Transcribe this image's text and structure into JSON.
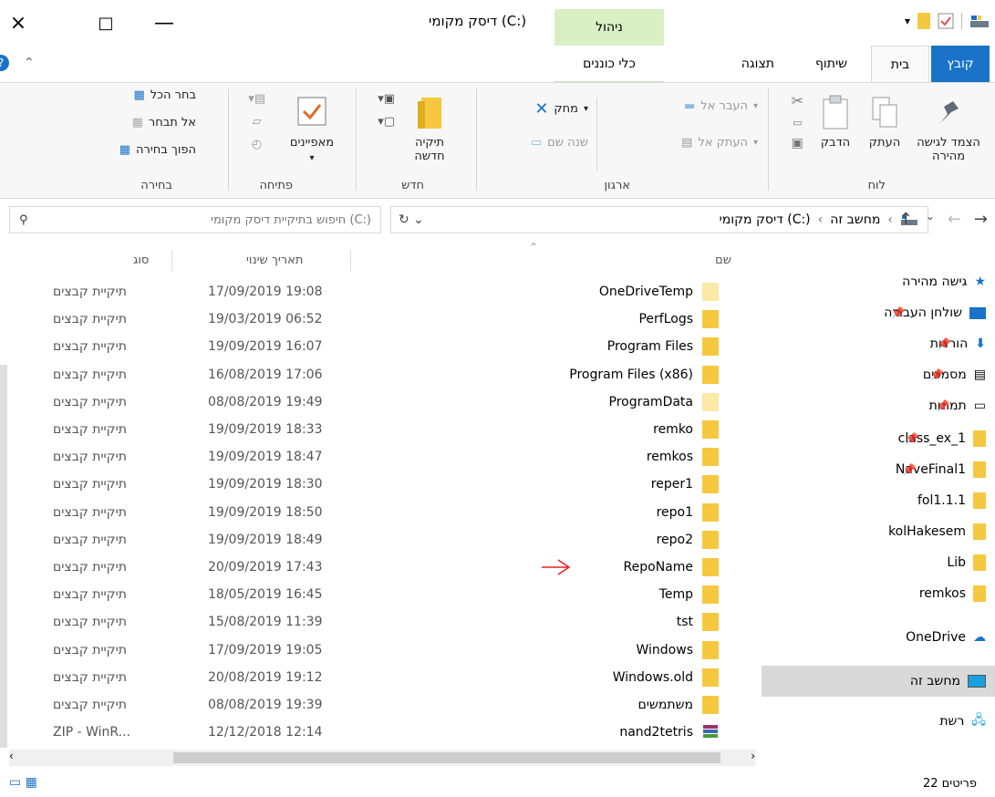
{
  "window": {
    "title": "דיסק מקומי (C:)",
    "manage_label": "ניהול",
    "close": "×",
    "maximize": "□",
    "minimize": "—"
  },
  "tabs": {
    "file": "קובץ",
    "home": "בית",
    "share": "שיתוף",
    "view": "תצוגה",
    "drive_tools": "כלי כוננים"
  },
  "ribbon": {
    "clipboard": {
      "label": "לוח",
      "pin": "הצמד לגישה מהירה",
      "copy": "העתק",
      "paste": "הדבק"
    },
    "organize": {
      "label": "ארגון",
      "move_to": "העבר אל",
      "copy_to": "העתק אל",
      "delete": "מחק",
      "rename": "שנה שם"
    },
    "new": {
      "label": "חדש",
      "new_folder": "תיקיה חדשה"
    },
    "open": {
      "label": "פתיחה",
      "properties": "מאפיינים"
    },
    "select": {
      "label": "בחירה",
      "select_all": "בחר הכל",
      "select_none": "אל תבחר",
      "invert": "הפוך בחירה"
    }
  },
  "address": {
    "this_pc": "מחשב זה",
    "drive": "דיסק מקומי (C:)",
    "search_placeholder": "חיפוש בתיקיית דיסק מקומי (C:)"
  },
  "columns": {
    "name": "שם",
    "date": "תאריך שינוי",
    "type": "סוג"
  },
  "files": [
    {
      "name": "OneDriveTemp",
      "date": "17/09/2019 19:08",
      "type": "תיקיית קבצים",
      "icon": "folder-light"
    },
    {
      "name": "PerfLogs",
      "date": "19/03/2019 06:52",
      "type": "תיקיית קבצים",
      "icon": "folder"
    },
    {
      "name": "Program Files",
      "date": "19/09/2019 16:07",
      "type": "תיקיית קבצים",
      "icon": "folder"
    },
    {
      "name": "Program Files (x86)",
      "date": "16/08/2019 17:06",
      "type": "תיקיית קבצים",
      "icon": "folder"
    },
    {
      "name": "ProgramData",
      "date": "08/08/2019 19:49",
      "type": "תיקיית קבצים",
      "icon": "folder-light"
    },
    {
      "name": "remko",
      "date": "19/09/2019 18:33",
      "type": "תיקיית קבצים",
      "icon": "folder"
    },
    {
      "name": "remkos",
      "date": "19/09/2019 18:47",
      "type": "תיקיית קבצים",
      "icon": "folder"
    },
    {
      "name": "reper1",
      "date": "19/09/2019 18:30",
      "type": "תיקיית קבצים",
      "icon": "folder"
    },
    {
      "name": "repo1",
      "date": "19/09/2019 18:50",
      "type": "תיקיית קבצים",
      "icon": "folder"
    },
    {
      "name": "repo2",
      "date": "19/09/2019 18:49",
      "type": "תיקיית קבצים",
      "icon": "folder"
    },
    {
      "name": "RepoName",
      "date": "20/09/2019 17:43",
      "type": "תיקיית קבצים",
      "icon": "folder"
    },
    {
      "name": "Temp",
      "date": "18/05/2019 16:45",
      "type": "תיקיית קבצים",
      "icon": "folder"
    },
    {
      "name": "tst",
      "date": "15/08/2019 11:39",
      "type": "תיקיית קבצים",
      "icon": "folder"
    },
    {
      "name": "Windows",
      "date": "17/09/2019 19:05",
      "type": "תיקיית קבצים",
      "icon": "folder"
    },
    {
      "name": "Windows.old",
      "date": "20/08/2019 19:12",
      "type": "תיקיית קבצים",
      "icon": "folder"
    },
    {
      "name": "משתמשים",
      "date": "08/08/2019 19:39",
      "type": "תיקיית קבצים",
      "icon": "folder"
    },
    {
      "name": "nand2tetris",
      "date": "12/12/2018 12:14",
      "type": "ZIP - WinR...",
      "icon": "winrar"
    }
  ],
  "nav": {
    "quick_access": "גישה מהירה",
    "desktop": "שולחן העבודה",
    "downloads": "הורדות",
    "documents": "מסמכים",
    "pictures": "תמונות",
    "class_ex_1": "class_ex_1",
    "navefinal1": "NaveFinal1",
    "fol111": "fol1.1.1",
    "kolhakesem": "kolHakesem",
    "lib": "Lib",
    "remkos": "remkos",
    "onedrive": "OneDrive",
    "this_pc": "מחשב זה",
    "network": "רשת"
  },
  "status": {
    "items": "22 פריטים"
  },
  "colors": {
    "accent": "#1a73c8",
    "folder": "#f5c840",
    "manage_tab": "#d8f0c4"
  }
}
